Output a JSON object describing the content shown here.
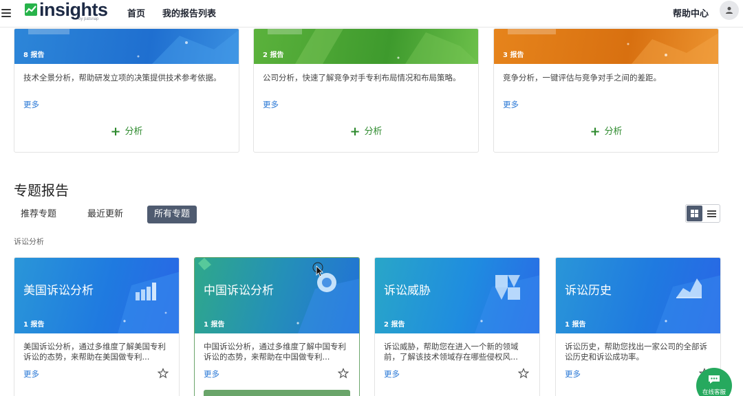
{
  "header": {
    "logo_text": "insights",
    "logo_sub": "by patsnap",
    "nav": [
      "首页",
      "我的报告列表"
    ],
    "help": "帮助中心"
  },
  "top_cards": [
    {
      "count": "8 报告",
      "desc": "技术全景分析，帮助研发立项的决策提供技术参考依据。",
      "more": "更多",
      "analyze": "分析",
      "color": "#2a7fd4"
    },
    {
      "count": "2 报告",
      "desc": "公司分析，快速了解竞争对手专利布局情况和布局策略。",
      "more": "更多",
      "analyze": "分析",
      "color": "#53a83a"
    },
    {
      "count": "3 报告",
      "desc": "竞争分析，一键评估与竞争对手之间的差距。",
      "more": "更多",
      "analyze": "分析",
      "color": "#e07a14"
    }
  ],
  "section": {
    "title": "专题报告",
    "tabs": [
      "推荐专题",
      "最近更新",
      "所有专题"
    ],
    "active_tab": "所有专题",
    "subcategory": "诉讼分析"
  },
  "report_cards": [
    {
      "title": "美国诉讼分析",
      "count": "1 报告",
      "desc": "美国诉讼分析，通过多维度了解美国专利诉讼的态势，来帮助在美国做专利...",
      "more": "更多"
    },
    {
      "title": "中国诉讼分析",
      "count": "1 报告",
      "desc": "中国诉讼分析，通过多维度了解中国专利诉讼的态势，来帮助在中国做专利...",
      "more": "更多"
    },
    {
      "title": "诉讼威胁",
      "count": "2 报告",
      "desc": "诉讼威胁，帮助您在进入一个新的领域前，了解该技术领域存在哪些侵权风...",
      "more": "更多"
    },
    {
      "title": "诉讼历史",
      "count": "1 报告",
      "desc": "诉讼历史，帮助您找出一家公司的全部诉讼历史和诉讼成功率。",
      "more": "更多"
    }
  ],
  "chat": {
    "label": "在线客服"
  },
  "colors": {
    "accent": "#2b79d6",
    "green": "#2d8a2d",
    "tab_active": "#4f5b70"
  }
}
